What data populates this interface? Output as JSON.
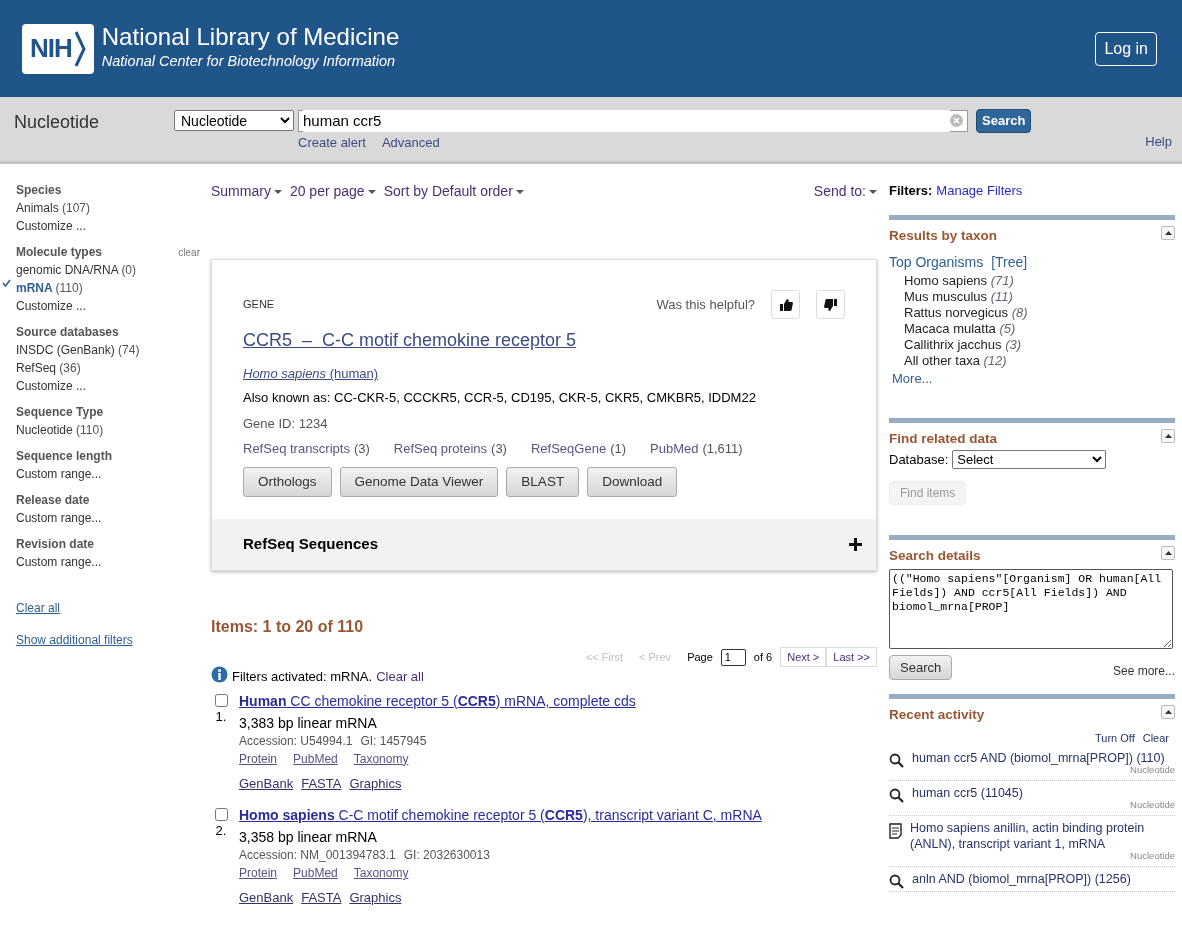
{
  "header": {
    "logo_text": "NIH",
    "title": "National Library of Medicine",
    "subtitle": "National Center for Biotechnology Information",
    "login_button": "Log in"
  },
  "search_bar": {
    "database_label": "Nucleotide",
    "database_select": "Nucleotide",
    "query": "human ccr5",
    "search_button": "Search",
    "links": [
      "Create alert",
      "Advanced"
    ],
    "help": "Help"
  },
  "sidebar": {
    "groups": [
      {
        "title": "Species",
        "items": [
          {
            "kind": "filter",
            "label": "Animals",
            "count": "(107)",
            "selected": false
          },
          {
            "kind": "customize",
            "label": "Customize ...",
            "selected": false
          }
        ]
      },
      {
        "title": "Molecule types",
        "clear": "clear",
        "items": [
          {
            "kind": "filter",
            "label": "genomic DNA/RNA",
            "count": "(0)",
            "selected": false
          },
          {
            "kind": "filter",
            "label": "mRNA",
            "count": "(110)",
            "selected": true
          },
          {
            "kind": "customize",
            "label": "Customize ...",
            "selected": false
          }
        ]
      },
      {
        "title": "Source databases",
        "items": [
          {
            "kind": "filter",
            "label": "INSDC (GenBank)",
            "count": "(74)",
            "selected": false
          },
          {
            "kind": "filter",
            "label": "RefSeq",
            "count": "(36)",
            "selected": false
          },
          {
            "kind": "customize",
            "label": "Customize ...",
            "selected": false
          }
        ]
      },
      {
        "title": "Sequence Type",
        "items": [
          {
            "kind": "filter",
            "label": "Nucleotide",
            "count": "(110)",
            "selected": false
          }
        ]
      },
      {
        "title": "Sequence length",
        "items": [
          {
            "kind": "customize",
            "label": "Custom range...",
            "selected": false
          }
        ]
      },
      {
        "title": "Release date",
        "items": [
          {
            "kind": "customize",
            "label": "Custom range...",
            "selected": false
          }
        ]
      },
      {
        "title": "Revision date",
        "items": [
          {
            "kind": "customize",
            "label": "Custom range...",
            "selected": false
          }
        ]
      }
    ],
    "links": [
      "Clear all",
      "Show additional filters"
    ]
  },
  "toolbar": {
    "options": [
      "Summary",
      "20 per page",
      "Sort by Default order"
    ],
    "send_to": "Send to:"
  },
  "gene_card": {
    "category": "GENE",
    "helpful_prompt": "Was this helpful?",
    "title": "CCR5  –  C-C motif chemokine receptor 5",
    "organism": "*Homo sapiens* (human)",
    "also_known_as": "Also known as: CC-CKR-5, CCCKR5, CCR-5, CD195, CKR-5, CKR5, CMKBR5, IDDM22",
    "gene_id": "Gene ID: 1234",
    "links": [
      {
        "label": "RefSeq transcripts",
        "count": "(3)"
      },
      {
        "label": "RefSeq proteins",
        "count": "(3)"
      },
      {
        "label": "RefSeqGene",
        "count": "(1)"
      },
      {
        "label": "PubMed",
        "count": "(1,611)"
      }
    ],
    "buttons": [
      "Orthologs",
      "Genome Data Viewer",
      "BLAST",
      "Download"
    ],
    "section": {
      "title": "RefSeq Sequences",
      "expanded": false
    }
  },
  "results": {
    "heading": "Items: 1 to 20 of 110",
    "pager": {
      "first": "<< First",
      "prev": "< Prev",
      "page_label": "Page",
      "page": "1",
      "of": "of 6",
      "next": "Next >",
      "last": "Last >>"
    },
    "filter_notice": "Filters activated: mRNA.",
    "clear_all": "Clear all",
    "rows": [
      {
        "number": "1.",
        "checked": false,
        "title": "**Human** CC chemokine receptor 5 (**CCR5**) mRNA, complete cds",
        "description": "3,383 bp linear mRNA",
        "accession": "Accession: U54994.1",
        "gi": "GI: 1457945",
        "links": [
          "Protein",
          "PubMed",
          "Taxonomy"
        ],
        "formats": [
          "GenBank",
          "FASTA",
          "Graphics"
        ]
      },
      {
        "number": "2.",
        "checked": false,
        "title": "**Homo sapiens** C-C motif chemokine receptor 5 (**CCR5**), transcript variant C, mRNA",
        "description": "3,358 bp linear mRNA",
        "accession": "Accession: NM_001394783.1",
        "gi": "GI: 2032630013",
        "links": [
          "Protein",
          "PubMed",
          "Taxonomy"
        ],
        "formats": [
          "GenBank",
          "FASTA",
          "Graphics"
        ]
      }
    ]
  },
  "right": {
    "filters_label": "Filters:",
    "manage_filters": "Manage Filters",
    "taxon": {
      "title": "Results by taxon",
      "top": "Top Organisms",
      "tree": "[Tree]",
      "organisms": [
        {
          "name": "Homo sapiens",
          "count": "(71)"
        },
        {
          "name": "Mus musculus",
          "count": "(11)"
        },
        {
          "name": "Rattus norvegicus",
          "count": "(8)"
        },
        {
          "name": "Macaca mulatta",
          "count": "(5)"
        },
        {
          "name": "Callithrix jacchus",
          "count": "(3)"
        },
        {
          "name": "All other taxa",
          "count": "(12)"
        }
      ],
      "more": "More..."
    },
    "related": {
      "title": "Find related data",
      "database_label": "Database:",
      "select": "Select",
      "button": "Find items",
      "disabled": true
    },
    "details": {
      "title": "Search details",
      "query": "((\"Homo sapiens\"[Organism] OR human[All Fields]) AND ccr5[All Fields]) AND biomol_mrna[PROP]",
      "button": "Search",
      "see_more": "See more..."
    },
    "recent": {
      "title": "Recent activity",
      "links": [
        "Turn Off",
        "Clear"
      ],
      "items": [
        {
          "kind": "search",
          "text": "human ccr5 AND (biomol_mrna[PROP]) (110)",
          "database": "Nucleotide"
        },
        {
          "kind": "search",
          "text": "human ccr5 (11045)",
          "database": "Nucleotide"
        },
        {
          "kind": "record",
          "text": "Homo sapiens anillin, actin binding protein (ANLN), transcript variant 1, mRNA",
          "database": "Nucleotide"
        },
        {
          "kind": "search",
          "text": "anln AND (biomol_mrna[PROP]) (1256)"
        }
      ]
    }
  }
}
